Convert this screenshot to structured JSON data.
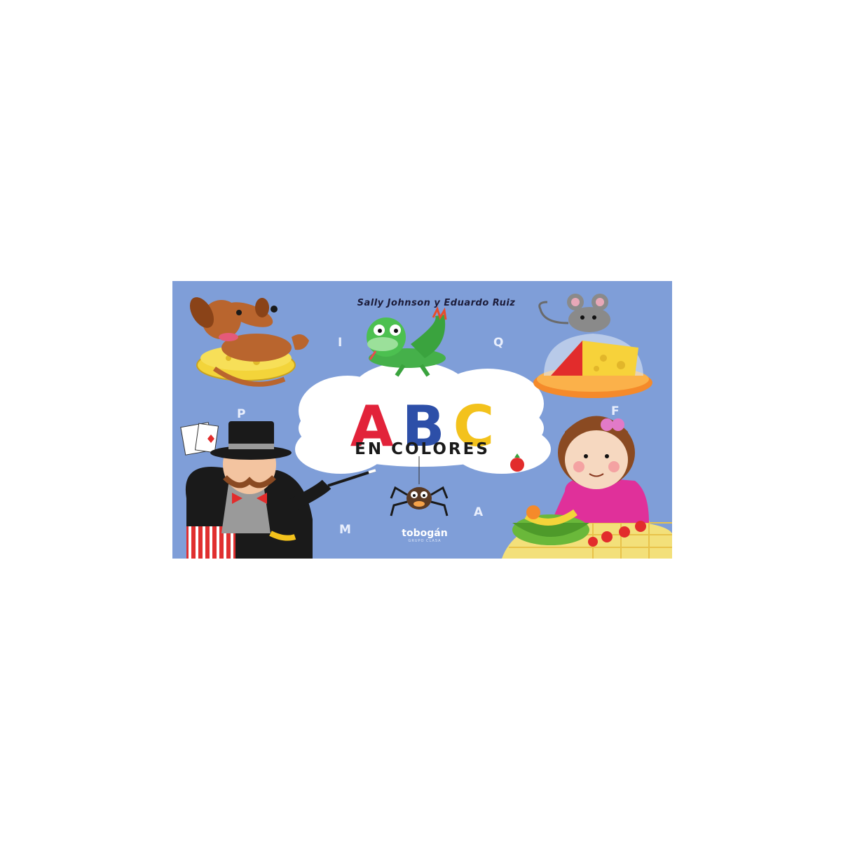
{
  "cover": {
    "authors": "Sally Johnson y Eduardo Ruiz",
    "title_letters": [
      {
        "char": "A",
        "color": "#e2233a"
      },
      {
        "char": "B",
        "color": "#2d4fa8"
      },
      {
        "char": "C",
        "color": "#f3c21c"
      }
    ],
    "subtitle": "EN COLORES",
    "scattered_letters": [
      "I",
      "Q",
      "P",
      "F",
      "M",
      "A"
    ],
    "publisher": {
      "name": "tobogán",
      "tagline": "GRUPO CLASA"
    },
    "background_color": "#7f9ed8",
    "illustrations": [
      "dog-on-cushion",
      "iguana",
      "mouse-on-cheese",
      "magician",
      "spider",
      "girl-with-fruit"
    ]
  }
}
